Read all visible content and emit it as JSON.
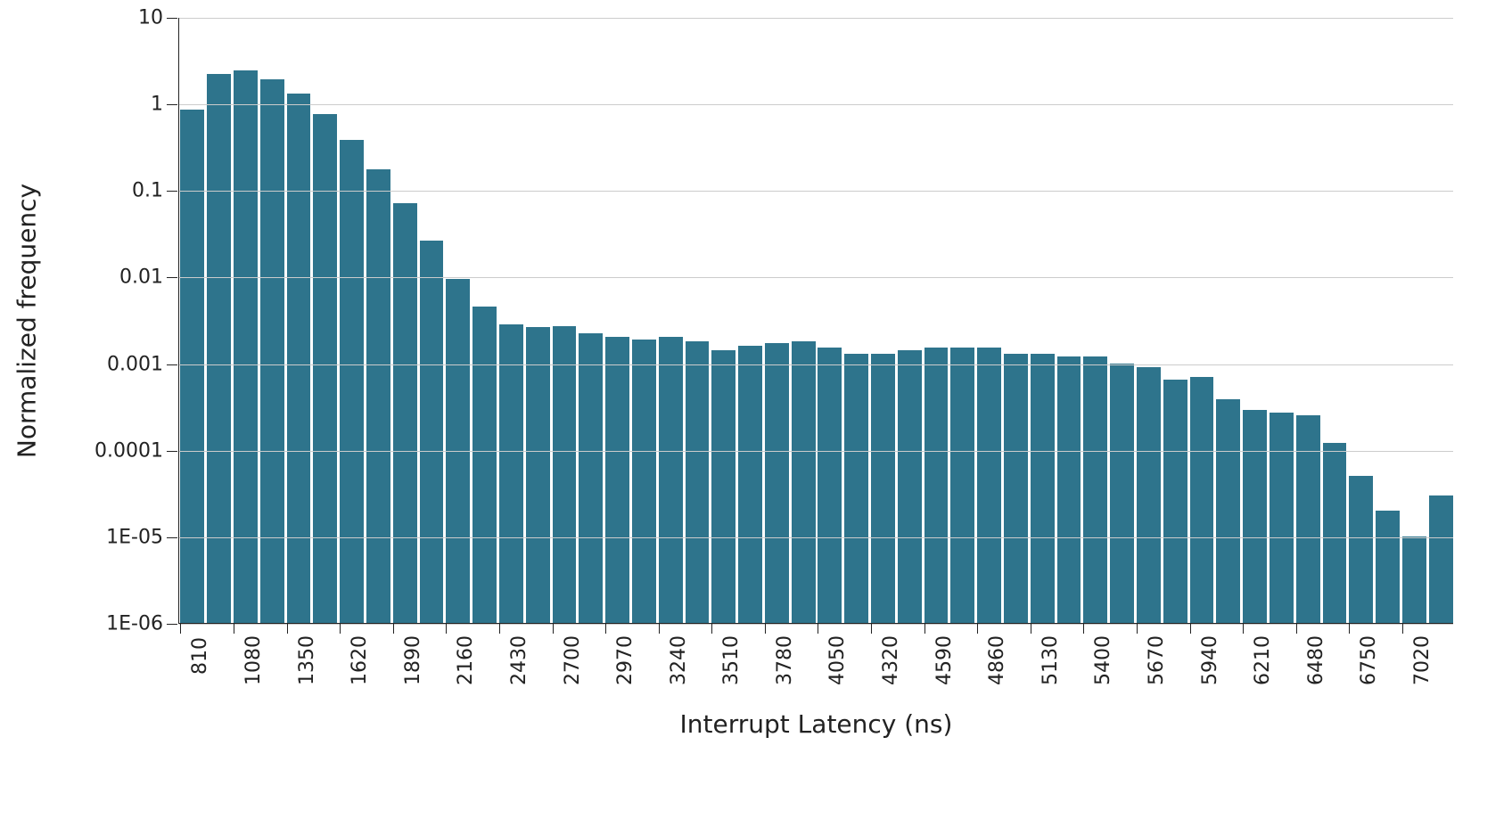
{
  "chart_data": {
    "type": "bar",
    "title": "",
    "xlabel": "Interrupt Latency (ns)",
    "ylabel": "Normalized frequency",
    "y_scale": "log",
    "ylim": [
      1e-06,
      10
    ],
    "y_ticks": [
      1e-06,
      1e-05,
      0.0001,
      0.001,
      0.01,
      0.1,
      1,
      10
    ],
    "y_tick_labels": [
      "1E-06",
      "1E-05",
      "0.0001",
      "0.001",
      "0.01",
      "0.1",
      "1",
      "10"
    ],
    "bin_width_ns": 135,
    "categories": [
      810,
      945,
      1080,
      1215,
      1350,
      1485,
      1620,
      1755,
      1890,
      2025,
      2160,
      2295,
      2430,
      2565,
      2700,
      2835,
      2970,
      3105,
      3240,
      3375,
      3510,
      3645,
      3780,
      3915,
      4050,
      4185,
      4320,
      4455,
      4590,
      4725,
      4860,
      4995,
      5130,
      5265,
      5400,
      5535,
      5670,
      5805,
      5940,
      6075,
      6210,
      6345,
      6480,
      6615,
      6750,
      6885,
      7020,
      7155
    ],
    "values": [
      0.85,
      2.2,
      2.4,
      1.9,
      1.3,
      0.75,
      0.38,
      0.175,
      0.07,
      0.026,
      0.0095,
      0.0045,
      0.0028,
      0.0026,
      0.0027,
      0.0022,
      0.002,
      0.0019,
      0.002,
      0.0018,
      0.0014,
      0.0016,
      0.0017,
      0.0018,
      0.0015,
      0.0013,
      0.0013,
      0.0014,
      0.0015,
      0.0015,
      0.0015,
      0.0013,
      0.0013,
      0.0012,
      0.0012,
      0.001,
      0.0009,
      0.00065,
      0.0007,
      0.00038,
      0.00029,
      0.00027,
      0.00025,
      0.00012,
      5e-05,
      2e-05,
      1e-05,
      3e-05
    ],
    "x_tick_labels_shown": [
      810,
      1080,
      1350,
      1620,
      1890,
      2160,
      2430,
      2700,
      2970,
      3240,
      3510,
      3780,
      4050,
      4320,
      4590,
      4860,
      5130,
      5400,
      5670,
      5940,
      6210,
      6480,
      6750,
      7020
    ],
    "bar_color": "#2e748c"
  }
}
